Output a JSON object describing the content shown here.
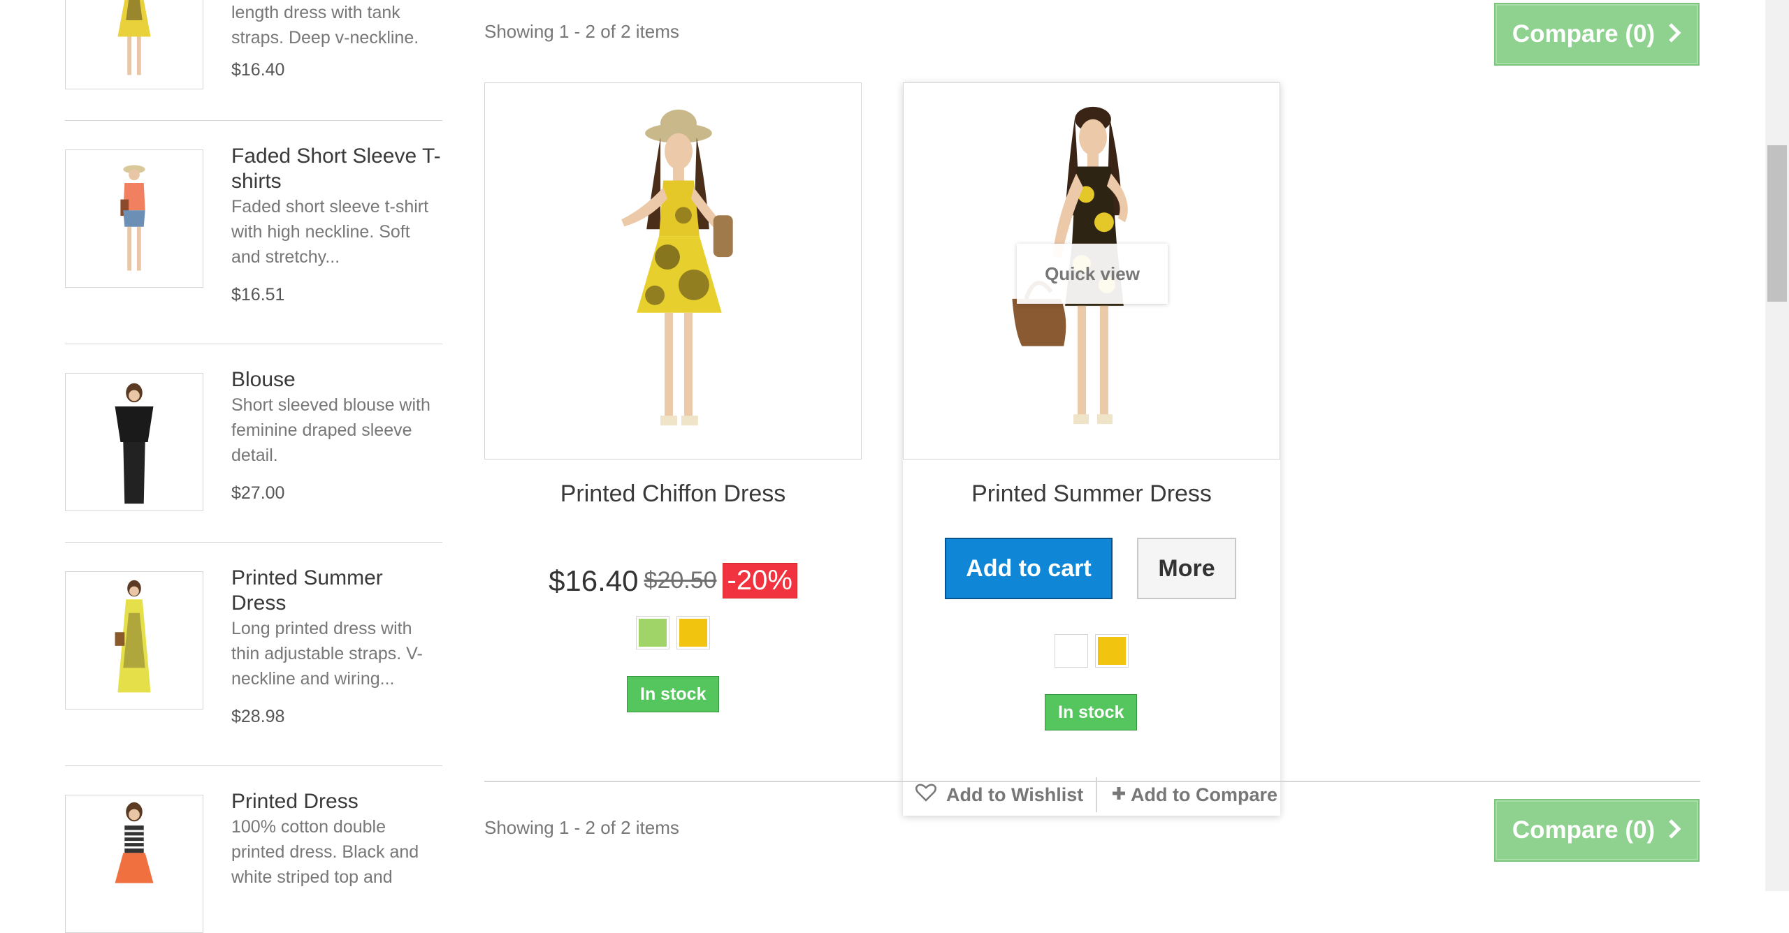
{
  "sidebar": {
    "items": [
      {
        "name": "",
        "description": "length dress with tank straps. Deep v-neckline.",
        "price": "$16.40"
      },
      {
        "name": "Faded Short Sleeve T-shirts",
        "description": "Faded short sleeve t-shirt with high neckline. Soft and stretchy...",
        "price": "$16.51"
      },
      {
        "name": "Blouse",
        "description": "Short sleeved blouse with feminine draped sleeve detail.",
        "price": "$27.00"
      },
      {
        "name": "Printed Summer Dress",
        "description": "Long printed dress with thin adjustable straps. V-neckline and wiring...",
        "price": "$28.98"
      },
      {
        "name": "Printed Dress",
        "description": "100% cotton double printed dress. Black and white striped top and",
        "price": ""
      }
    ]
  },
  "listing": {
    "showing_text": "Showing 1 - 2 of 2 items",
    "compare_label": "Compare (0)"
  },
  "products": [
    {
      "name": "Printed Chiffon Dress",
      "price": "$16.40",
      "old_price": "$20.50",
      "discount": "-20%",
      "colors": [
        "#a0d468",
        "#f1c40f"
      ],
      "availability": "In stock"
    },
    {
      "name": "Printed Summer Dress",
      "quick_view": "Quick view",
      "add_to_cart": "Add to cart",
      "more": "More",
      "colors": [
        "#ffffff",
        "#f1c40f"
      ],
      "availability": "In stock",
      "wishlist": "Add to Wishlist",
      "compare": "Add to Compare"
    }
  ],
  "icons": {
    "compare_chevron": "chevron-right-icon",
    "wishlist": "heart-icon",
    "compare": "plus-icon"
  },
  "colors": {
    "compare_green": "#8fd18e",
    "cart_blue": "#0f86d6",
    "discount_red": "#f13340",
    "stock_green": "#55c65e"
  }
}
